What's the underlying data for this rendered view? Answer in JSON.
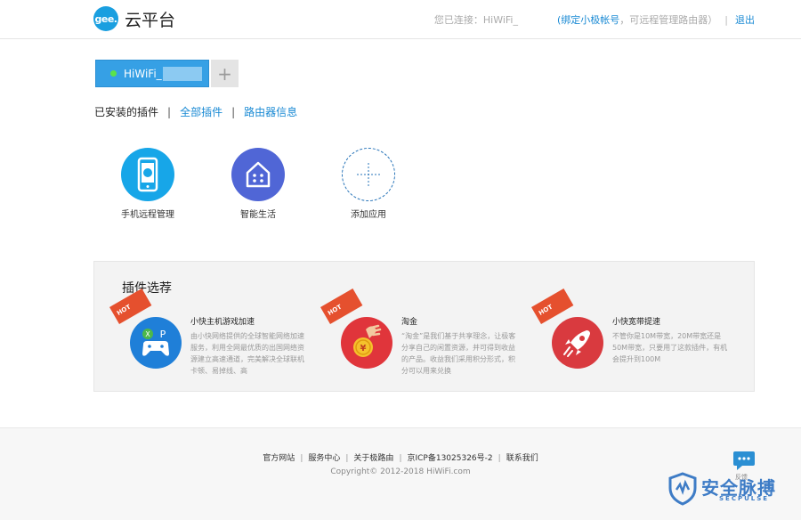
{
  "header": {
    "logo_badge": "gee.",
    "logo_text": "云平台",
    "connected_label": "您已连接：HiWiFi_",
    "bind_link": "(绑定小极帐号",
    "bind_suffix": "，可远程管理路由器）",
    "separator": "|",
    "logout": "退出"
  },
  "router_tab": {
    "name": "HiWiFi_",
    "add_symbol": "+"
  },
  "plugin_nav": {
    "installed": "已安装的插件",
    "all_plugins": "全部插件",
    "router_info": "路由器信息",
    "divider": "|"
  },
  "installed_apps": [
    {
      "label": "手机远程管理",
      "icon": "phone-icon"
    },
    {
      "label": "智能生活",
      "icon": "smart-home-icon"
    },
    {
      "label": "添加应用",
      "icon": "plus-icon"
    }
  ],
  "recommend": {
    "title": "插件选荐",
    "hot_label": "HOT",
    "items": [
      {
        "name": "小快主机游戏加速",
        "desc": "由小快网络提供的全球智能网络加速服务，利用全网最优质的出国网络资源建立高速通道，完美解决全球联机卡顿、易掉线、高",
        "icon": "gamepad-icon",
        "color": "#1f7fd8"
      },
      {
        "name": "淘金",
        "desc": "“淘金”是我们基于共享理念，让极客分享自己的闲置资源，并可得到收益的产品。收益我们采用积分形式，积分可以用来兑换",
        "icon": "coin-hand-icon",
        "color": "#e0353b"
      },
      {
        "name": "小快宽带提速",
        "desc": "不管你是10M带宽，20M带宽还是50M带宽，只要用了这款插件，有机会提升到100M",
        "icon": "rocket-icon",
        "color": "#d93a3f"
      }
    ]
  },
  "footer": {
    "links": [
      "官方网站",
      "服务中心",
      "关于极路由",
      "京ICP备13025326号-2",
      "联系我们"
    ],
    "copyright": "Copyright© 2012-2018 HiWiFi.com"
  },
  "chat": {
    "label": "反馈"
  },
  "watermark": {
    "text": "安全脉搏",
    "sub": "SECPULSE"
  },
  "colors": {
    "accent": "#1a8ad4",
    "tab": "#36a0e5",
    "hot": "#e5502e"
  }
}
